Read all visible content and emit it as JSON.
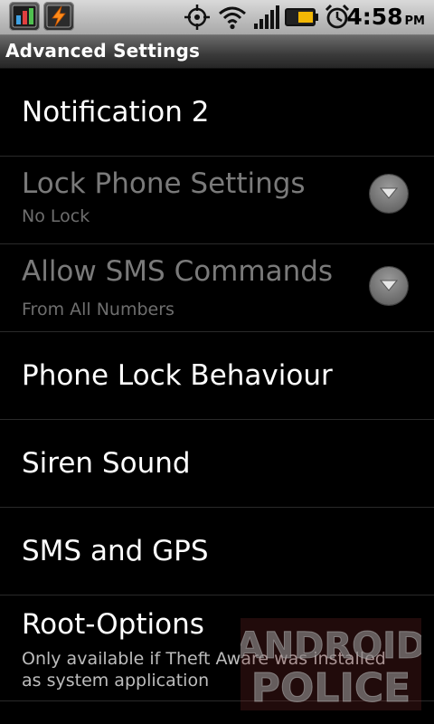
{
  "status_bar": {
    "time": "4:58",
    "ampm": "PM"
  },
  "title_bar": {
    "title": "Advanced Settings"
  },
  "settings": [
    {
      "title": "Notification 2",
      "summary": "",
      "disabled": false,
      "has_dropdown": false
    },
    {
      "title": "Lock Phone Settings",
      "summary": "No Lock",
      "disabled": true,
      "has_dropdown": true
    },
    {
      "title": "Allow SMS Commands",
      "summary": "From All Numbers",
      "disabled": true,
      "has_dropdown": true
    },
    {
      "title": "Phone Lock Behaviour",
      "summary": "",
      "disabled": false,
      "has_dropdown": false
    },
    {
      "title": "Siren Sound",
      "summary": "",
      "disabled": false,
      "has_dropdown": false
    },
    {
      "title": "SMS and GPS",
      "summary": "",
      "disabled": false,
      "has_dropdown": false
    },
    {
      "title": "Root-Options",
      "summary": "Only available if Theft Aware was installed as system application",
      "disabled": false,
      "has_dropdown": false
    }
  ],
  "watermark": {
    "line1": "ANDROID",
    "line2": "POLICE"
  },
  "icons": [
    "taskmanager-icon",
    "lightning-app-icon",
    "gps-icon",
    "wifi-icon",
    "signal-icon",
    "battery-icon",
    "alarm-icon",
    "dropdown-arrow-icon"
  ],
  "colors": {
    "background": "#000000",
    "disabled_text": "#7a7a7a",
    "status_bar": "#c4c4c4",
    "battery_fill": "#f2b705"
  }
}
